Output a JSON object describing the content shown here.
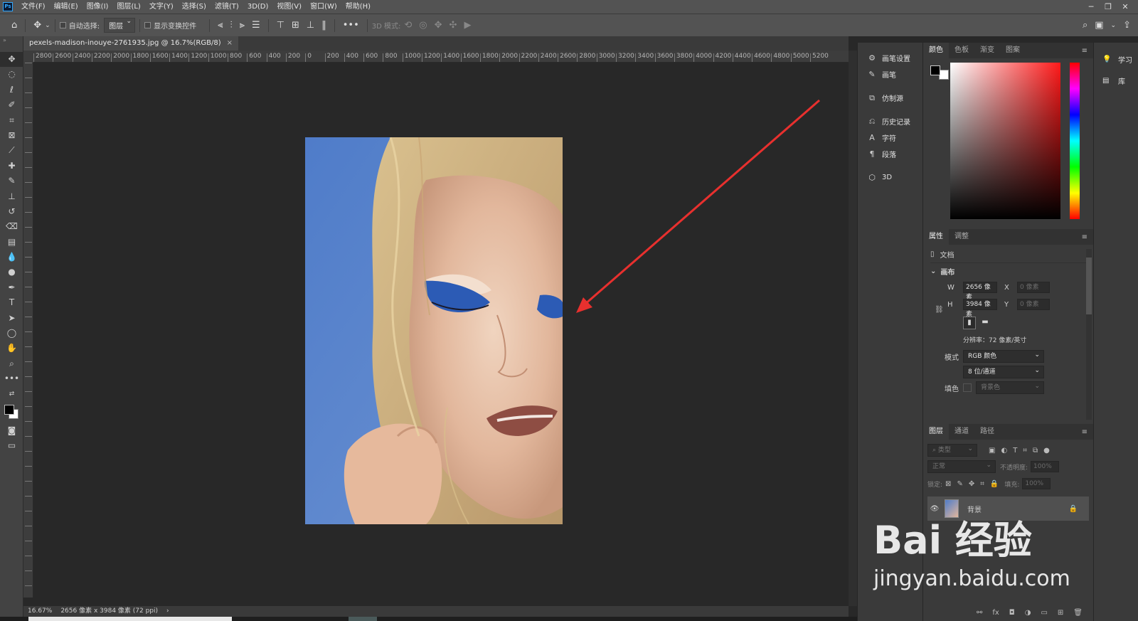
{
  "app": {
    "logo": "Ps"
  },
  "menu": [
    "文件(F)",
    "编辑(E)",
    "图像(I)",
    "图层(L)",
    "文字(Y)",
    "选择(S)",
    "滤镜(T)",
    "3D(D)",
    "视图(V)",
    "窗口(W)",
    "帮助(H)"
  ],
  "window_controls": {
    "minimize": "─",
    "restore": "❐",
    "close": "✕"
  },
  "options": {
    "auto_select_label": "自动选择:",
    "auto_select_value": "图层",
    "show_transform_label": "显示变换控件",
    "mode_3d_label": "3D 模式:",
    "more": "•••"
  },
  "document": {
    "tab_title": "pexels-madison-inouye-2761935.jpg @ 16.7%(RGB/8)",
    "close": "×"
  },
  "rulers": {
    "top": [
      "2800",
      "2600",
      "2400",
      "2200",
      "2000",
      "1800",
      "1600",
      "1400",
      "1200",
      "1000",
      "800",
      "600",
      "400",
      "200",
      "0",
      "200",
      "400",
      "600",
      "800",
      "1000",
      "1200",
      "1400",
      "1600",
      "1800",
      "2000",
      "2200",
      "2400",
      "2600",
      "2800",
      "3000",
      "3200",
      "3400",
      "3600",
      "3800",
      "4000",
      "4200",
      "4400",
      "4600",
      "4800",
      "5000",
      "5200"
    ]
  },
  "status": {
    "zoom": "16.67%",
    "info": "2656 像素 x 3984 像素 (72 ppi)",
    "chevron": "›"
  },
  "mid_panel": [
    {
      "icon": "brush-settings-icon",
      "glyph": "⚙",
      "label": "画笔设置"
    },
    {
      "icon": "brush-icon",
      "glyph": "✎",
      "label": "画笔"
    },
    {
      "icon": "clone-source-icon",
      "glyph": "⧉",
      "label": "仿制源"
    },
    {
      "icon": "history-icon",
      "glyph": "⎌",
      "label": "历史记录"
    },
    {
      "icon": "character-icon",
      "glyph": "A",
      "label": "字符"
    },
    {
      "icon": "paragraph-icon",
      "glyph": "¶",
      "label": "段落"
    },
    {
      "icon": "3d-icon",
      "glyph": "⬡",
      "label": "3D"
    }
  ],
  "color_panel": {
    "tabs": [
      "颜色",
      "色板",
      "渐变",
      "图案"
    ],
    "active_tab": "颜色",
    "foreground": "#000000",
    "background": "#ffffff",
    "picker_hue": "#ff1a1a"
  },
  "properties_panel": {
    "tabs": [
      "属性",
      "调整"
    ],
    "doc_label": "文档",
    "section": "画布",
    "w_label": "W",
    "w_value": "2656 像素",
    "h_label": "H",
    "h_value": "3984 像素",
    "x_label": "X",
    "x_value": "0 像素",
    "y_label": "Y",
    "y_value": "0 像素",
    "resolution": "分辨率：72 像素/英寸",
    "mode_label": "模式",
    "mode_value": "RGB 颜色",
    "depth_value": "8 位/通道",
    "fill_label": "填色",
    "fill_value": "背景色"
  },
  "layers_panel": {
    "tabs": [
      "图层",
      "通道",
      "路径"
    ],
    "filter_value": "类型",
    "blend_value": "正常",
    "opacity_label": "不透明度:",
    "opacity_value": "100%",
    "lock_label": "锁定:",
    "fill_label": "填充:",
    "fill_value": "100%",
    "layer_name": "背景"
  },
  "far_right": [
    {
      "icon": "learn-icon",
      "glyph": "💡",
      "label": "学习"
    },
    {
      "icon": "libraries-icon",
      "glyph": "▤",
      "label": "库"
    }
  ],
  "watermark": {
    "main": "Bai  经验",
    "sub": "jingyan.baidu.com"
  },
  "annotation_color": "#e8302e"
}
